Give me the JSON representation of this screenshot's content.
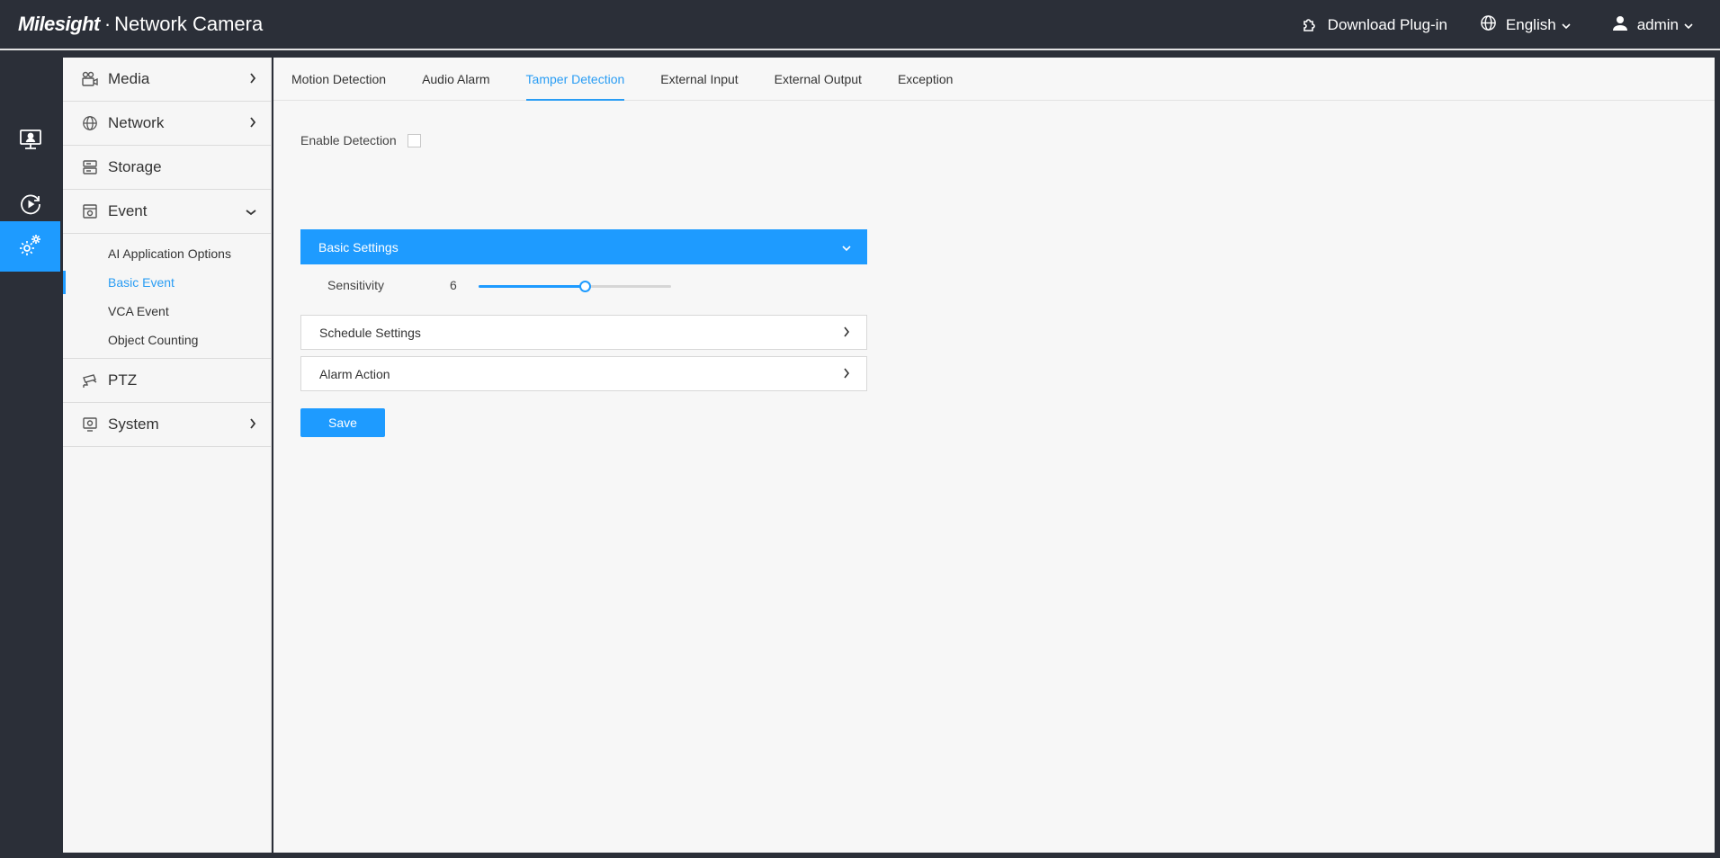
{
  "header": {
    "brand_logo": "Milesight",
    "brand_separator": "·",
    "brand_product": "Network Camera",
    "download_label": "Download Plug-in",
    "language_label": "English",
    "user_label": "admin"
  },
  "rail": {
    "items": [
      {
        "icon": "live-view-icon",
        "active": false
      },
      {
        "icon": "playback-icon",
        "active": false
      },
      {
        "icon": "settings-icon",
        "active": true
      }
    ]
  },
  "sidebar": {
    "items": [
      {
        "label": "Media",
        "icon": "camera-icon",
        "arrow": "right"
      },
      {
        "label": "Network",
        "icon": "globe-icon",
        "arrow": "right"
      },
      {
        "label": "Storage",
        "icon": "storage-icon",
        "arrow": "none"
      },
      {
        "label": "Event",
        "icon": "event-icon",
        "arrow": "down"
      },
      {
        "label": "PTZ",
        "icon": "ptz-icon",
        "arrow": "none"
      },
      {
        "label": "System",
        "icon": "system-icon",
        "arrow": "right"
      }
    ],
    "event_sub": [
      {
        "label": "AI Application Options",
        "active": false
      },
      {
        "label": "Basic Event",
        "active": true
      },
      {
        "label": "VCA Event",
        "active": false
      },
      {
        "label": "Object Counting",
        "active": false
      }
    ]
  },
  "tabs": [
    {
      "label": "Motion Detection",
      "active": false
    },
    {
      "label": "Audio Alarm",
      "active": false
    },
    {
      "label": "Tamper Detection",
      "active": true
    },
    {
      "label": "External Input",
      "active": false
    },
    {
      "label": "External Output",
      "active": false
    },
    {
      "label": "Exception",
      "active": false
    }
  ],
  "content": {
    "enable_label": "Enable Detection",
    "enable_checked": false,
    "basic_settings_label": "Basic Settings",
    "sensitivity_label": "Sensitivity",
    "sensitivity_value": "6",
    "sensitivity_fraction": 0.55,
    "schedule_label": "Schedule Settings",
    "alarm_label": "Alarm Action",
    "save_label": "Save"
  },
  "colors": {
    "accent": "#1e9bff",
    "header_bg": "#2b2f38",
    "active_text": "#2a9df4"
  }
}
